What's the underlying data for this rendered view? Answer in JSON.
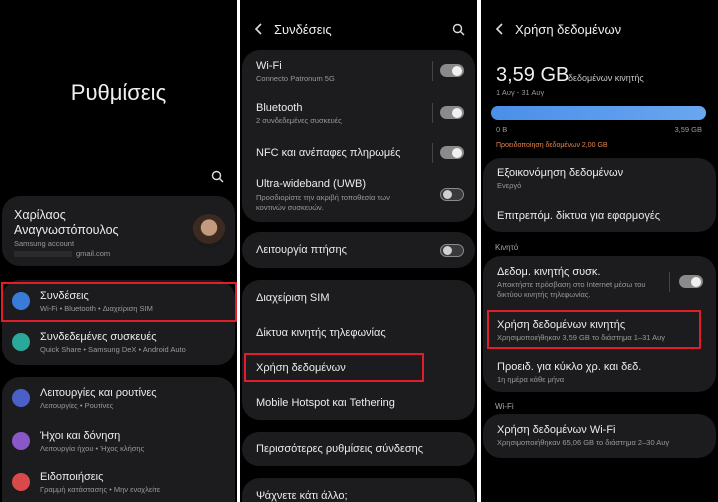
{
  "panel1": {
    "title": "Ρυθμίσεις",
    "profile": {
      "name_line1": "Χαρίλαος",
      "name_line2": "Αναγνωστόπουλος",
      "account_label": "Samsung account",
      "email": "gmail.com"
    },
    "items": [
      {
        "label": "Συνδέσεις",
        "sub": "Wi-Fi • Bluetooth • Διαχείριση SIM",
        "color": "#3b7bd8"
      },
      {
        "label": "Συνδεδεμένες συσκευές",
        "sub": "Quick Share • Samsung DeX • Android Auto",
        "color": "#2aa89a"
      },
      {
        "label": "Λειτουργίες και ρουτίνες",
        "sub": "Λειτουργίες • Ρουτίνες",
        "color": "#4a5fc8"
      },
      {
        "label": "Ήχοι και δόνηση",
        "sub": "Λειτουργία ήχου • Ήχος κλήσης",
        "color": "#8a57c8"
      },
      {
        "label": "Ειδοποιήσεις",
        "sub": "Γραμμή κατάστασης • Μην ενοχλείτε",
        "color": "#d84a4a"
      }
    ]
  },
  "panel2": {
    "title": "Συνδέσεις",
    "wifi": {
      "label": "Wi-Fi",
      "sub": "Connecto Patronum 5G"
    },
    "bluetooth": {
      "label": "Bluetooth",
      "sub": "2 συνδεδεμένες συσκευές"
    },
    "nfc": {
      "label": "NFC και ανέπαφες πληρωμές"
    },
    "uwb": {
      "label": "Ultra-wideband (UWB)",
      "sub1": "Προσδιορίστε την ακριβή τοποθεσία των",
      "sub2": "κοντινών συσκευών."
    },
    "flight": {
      "label": "Λειτουργία πτήσης"
    },
    "sim": "Διαχείριση SIM",
    "mobile_networks": "Δίκτυα κινητής τηλεφωνίας",
    "data_usage": "Χρήση δεδομένων",
    "hotspot": "Mobile Hotspot και Tethering",
    "more": "Περισσότερες ρυθμίσεις σύνδεσης",
    "search_prompt": "Ψάχνετε κάτι άλλο;"
  },
  "panel3": {
    "title": "Χρήση δεδομένων",
    "amount": "3,59 GB",
    "amount_label": "δεδομένων κινητής",
    "period": "1 Αυγ - 31 Αυγ",
    "bar": {
      "fill_fraction": 1.0,
      "min_label": "0 B",
      "max_label": "3,59 GB",
      "warning": "Προειδοποίηση δεδομένων 2,00 GB"
    },
    "saver": {
      "label": "Εξοικονόμηση δεδομένων",
      "sub": "Ενεργό"
    },
    "allowed_networks": "Επιτρεπόμ. δίκτυα για εφαρμογές",
    "section_mobile": "Κινητό",
    "mobile_data": {
      "label": "Δεδομ. κινητής συσκ.",
      "sub1": "Αποκτήστε πρόσβαση στο Internet μέσω του",
      "sub2": "δικτύου κινητής τηλεφωνίας."
    },
    "mobile_usage": {
      "label": "Χρήση δεδομένων κινητής",
      "sub": "Χρησιμοποιήθηκαν 3,59 GB το διάστημα 1–31 Αυγ"
    },
    "warning_cycle": {
      "label": "Προειδ. για κύκλο χρ. και δεδ.",
      "sub": "1η ημέρα κάθε μήνα"
    },
    "section_wifi": "Wi-Fi",
    "wifi_usage": {
      "label": "Χρήση δεδομένων Wi-Fi",
      "sub": "Χρησιμοποιήθηκαν 65,06 GB το διάστημα 2–30 Αυγ"
    }
  }
}
